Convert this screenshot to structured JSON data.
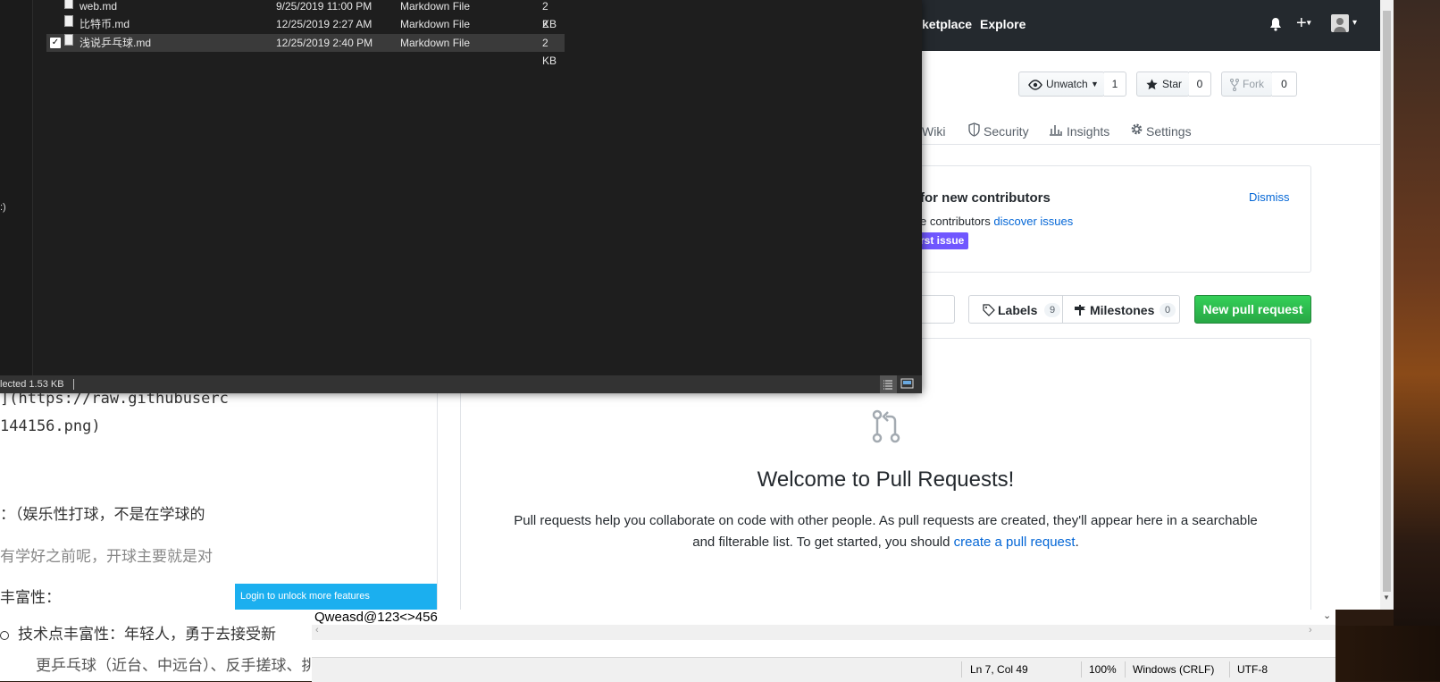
{
  "explorer": {
    "files": [
      {
        "name": "web.md",
        "modified": "9/25/2019 11:00 PM",
        "type": "Markdown File",
        "size": "2 KB"
      },
      {
        "name": "比特币.md",
        "modified": "12/25/2019 2:27 AM",
        "type": "Markdown File",
        "size": "2 KB"
      },
      {
        "name": "浅说乒乓球.md",
        "modified": "12/25/2019 2:40 PM",
        "type": "Markdown File",
        "size": "2 KB",
        "selected": true
      }
    ],
    "left_fragment": ":)",
    "status_text": "lected  1.53 KB"
  },
  "github": {
    "nav": {
      "marketplace": "ketplace",
      "explore": "Explore"
    },
    "repo_actions": {
      "unwatch_label": "Unwatch",
      "unwatch_count": "1",
      "star_label": "Star",
      "star_count": "0",
      "fork_label": "Fork",
      "fork_count": "0"
    },
    "tabs": {
      "wiki": "Wiki",
      "security": "Security",
      "insights": "Insights",
      "settings": "Settings"
    },
    "contributors": {
      "title": "for new contributors",
      "text": "e contributors ",
      "link": "discover issues",
      "label": "rst issue",
      "dismiss": "Dismiss"
    },
    "filters": {
      "labels": "Labels",
      "labels_count": "9",
      "milestones": "Milestones",
      "milestones_count": "0",
      "new_pr": "New pull request"
    },
    "blank": {
      "title": "Welcome to Pull Requests!",
      "line1": "Pull requests help you collaborate on code with other people. As pull requests are created, they'll appear here in a searchable",
      "line2_pre": "and filterable list. To get started, you should ",
      "line2_link": "create a pull request",
      "line2_post": "."
    },
    "login_bar": "Login to unlock more features"
  },
  "editor": {
    "line1": "](https://raw.githubuserc",
    "line2": "144156.png)",
    "line3": "：（娱乐性打球，不是在学球的",
    "line4": "有学好之前呢，开球主要就是对",
    "line5": "丰富性：",
    "line6": "技术点丰富性：年轻人，勇于去接受新",
    "line7": "更乒乓球（近台、中远台）、反手搓球、挑打、拉带、拍打、反手发小转拉）、反"
  },
  "notepad": {
    "text": "Qweasd@123<>456",
    "status": {
      "position": "Ln 7, Col 49",
      "zoom": "100%",
      "eol": "Windows (CRLF)",
      "encoding": "UTF-8"
    }
  },
  "colors": {
    "gh_header": "#24292e",
    "green": "#28a745",
    "link": "#0366d6",
    "label_purple": "#7057ff",
    "login_bar": "#1bafef"
  }
}
